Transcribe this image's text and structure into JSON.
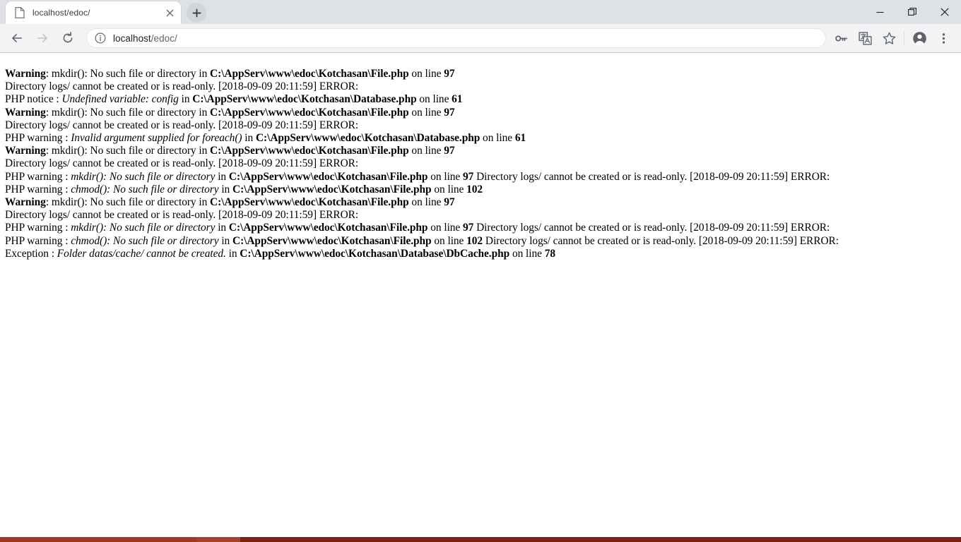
{
  "window": {
    "controls": [
      {
        "name": "minimize",
        "glyph": "minimize-icon"
      },
      {
        "name": "restore",
        "glyph": "restore-icon"
      },
      {
        "name": "close",
        "glyph": "close-icon"
      }
    ]
  },
  "tabstrip": {
    "tabs": [
      {
        "title": "localhost/edoc/",
        "favicon": "page-icon",
        "close_label": "×",
        "active": true
      }
    ],
    "new_tab_label": "+",
    "new_tab_tooltip": "New Tab"
  },
  "toolbar": {
    "back_label": "←",
    "forward_label": "→",
    "reload_label": "⟳",
    "info_icon": "info-circle-icon",
    "url_primary": "localhost",
    "url_secondary": "/edoc/",
    "url_full": "localhost/edoc/",
    "icons": [
      {
        "name": "password-key-icon",
        "label": "⚷"
      },
      {
        "name": "translate-icon",
        "label": "文"
      },
      {
        "name": "bookmark-star-icon",
        "label": "☆"
      },
      {
        "name": "profile-avatar-icon",
        "label": "●"
      },
      {
        "name": "more-menu-icon",
        "label": "⋮"
      }
    ]
  },
  "page": {
    "background_color": "#ffffff",
    "text_color": "#000000",
    "bottom_bar_colors": [
      "#9c3a25",
      "#a8422b",
      "#7b2312"
    ],
    "lines": [
      {
        "id": "line-1",
        "parts": [
          {
            "t": "Warning",
            "s": "b"
          },
          {
            "t": ": mkdir(): No such file or directory in ",
            "s": "n"
          },
          {
            "t": "C:\\AppServ\\www\\edoc\\Kotchasan\\File.php",
            "s": "b"
          },
          {
            "t": " on line ",
            "s": "n"
          },
          {
            "t": "97",
            "s": "b"
          }
        ]
      },
      {
        "id": "line-2",
        "parts": [
          {
            "t": "Directory logs/ cannot be created or is read-only. [2018-09-09 20:11:59] ERROR:",
            "s": "n"
          }
        ]
      },
      {
        "id": "line-3",
        "parts": [
          {
            "t": "PHP notice : ",
            "s": "n"
          },
          {
            "t": "Undefined variable: config",
            "s": "i"
          },
          {
            "t": " in ",
            "s": "n"
          },
          {
            "t": "C:\\AppServ\\www\\edoc\\Kotchasan\\Database.php",
            "s": "b"
          },
          {
            "t": " on line ",
            "s": "n"
          },
          {
            "t": "61",
            "s": "b"
          }
        ]
      },
      {
        "id": "line-4",
        "parts": [
          {
            "t": "Warning",
            "s": "b"
          },
          {
            "t": ": mkdir(): No such file or directory in ",
            "s": "n"
          },
          {
            "t": "C:\\AppServ\\www\\edoc\\Kotchasan\\File.php",
            "s": "b"
          },
          {
            "t": " on line ",
            "s": "n"
          },
          {
            "t": "97",
            "s": "b"
          }
        ]
      },
      {
        "id": "line-5",
        "parts": [
          {
            "t": "Directory logs/ cannot be created or is read-only. [2018-09-09 20:11:59] ERROR:",
            "s": "n"
          }
        ]
      },
      {
        "id": "line-6",
        "parts": [
          {
            "t": "PHP warning : ",
            "s": "n"
          },
          {
            "t": "Invalid argument supplied for foreach()",
            "s": "i"
          },
          {
            "t": " in ",
            "s": "n"
          },
          {
            "t": "C:\\AppServ\\www\\edoc\\Kotchasan\\Database.php",
            "s": "b"
          },
          {
            "t": " on line ",
            "s": "n"
          },
          {
            "t": "61",
            "s": "b"
          }
        ]
      },
      {
        "id": "line-7",
        "parts": [
          {
            "t": "Warning",
            "s": "b"
          },
          {
            "t": ": mkdir(): No such file or directory in ",
            "s": "n"
          },
          {
            "t": "C:\\AppServ\\www\\edoc\\Kotchasan\\File.php",
            "s": "b"
          },
          {
            "t": " on line ",
            "s": "n"
          },
          {
            "t": "97",
            "s": "b"
          }
        ]
      },
      {
        "id": "line-8",
        "parts": [
          {
            "t": "Directory logs/ cannot be created or is read-only. [2018-09-09 20:11:59] ERROR:",
            "s": "n"
          }
        ]
      },
      {
        "id": "line-9",
        "parts": [
          {
            "t": "PHP warning : ",
            "s": "n"
          },
          {
            "t": "mkdir(): No such file or directory",
            "s": "i"
          },
          {
            "t": " in ",
            "s": "n"
          },
          {
            "t": "C:\\AppServ\\www\\edoc\\Kotchasan\\File.php",
            "s": "b"
          },
          {
            "t": " on line ",
            "s": "n"
          },
          {
            "t": "97",
            "s": "b"
          },
          {
            "t": " Directory logs/ cannot be created or is read-only. [2018-09-09 20:11:59] ERROR:",
            "s": "n"
          }
        ]
      },
      {
        "id": "line-10",
        "parts": [
          {
            "t": "PHP warning : ",
            "s": "n"
          },
          {
            "t": "chmod(): No such file or directory",
            "s": "i"
          },
          {
            "t": " in ",
            "s": "n"
          },
          {
            "t": "C:\\AppServ\\www\\edoc\\Kotchasan\\File.php",
            "s": "b"
          },
          {
            "t": " on line ",
            "s": "n"
          },
          {
            "t": "102",
            "s": "b"
          }
        ]
      },
      {
        "id": "line-11",
        "parts": [
          {
            "t": "Warning",
            "s": "b"
          },
          {
            "t": ": mkdir(): No such file or directory in ",
            "s": "n"
          },
          {
            "t": "C:\\AppServ\\www\\edoc\\Kotchasan\\File.php",
            "s": "b"
          },
          {
            "t": " on line ",
            "s": "n"
          },
          {
            "t": "97",
            "s": "b"
          }
        ]
      },
      {
        "id": "line-12",
        "parts": [
          {
            "t": "Directory logs/ cannot be created or is read-only. [2018-09-09 20:11:59] ERROR:",
            "s": "n"
          }
        ]
      },
      {
        "id": "line-13",
        "parts": [
          {
            "t": "PHP warning : ",
            "s": "n"
          },
          {
            "t": "mkdir(): No such file or directory",
            "s": "i"
          },
          {
            "t": " in ",
            "s": "n"
          },
          {
            "t": "C:\\AppServ\\www\\edoc\\Kotchasan\\File.php",
            "s": "b"
          },
          {
            "t": " on line ",
            "s": "n"
          },
          {
            "t": "97",
            "s": "b"
          },
          {
            "t": " Directory logs/ cannot be created or is read-only. [2018-09-09 20:11:59] ERROR:",
            "s": "n"
          }
        ]
      },
      {
        "id": "line-14",
        "parts": [
          {
            "t": "PHP warning : ",
            "s": "n"
          },
          {
            "t": "chmod(): No such file or directory",
            "s": "i"
          },
          {
            "t": " in ",
            "s": "n"
          },
          {
            "t": "C:\\AppServ\\www\\edoc\\Kotchasan\\File.php",
            "s": "b"
          },
          {
            "t": " on line ",
            "s": "n"
          },
          {
            "t": "102",
            "s": "b"
          },
          {
            "t": " Directory logs/ cannot be created or is read-only. [2018-09-09 20:11:59] ERROR:",
            "s": "n"
          }
        ]
      },
      {
        "id": "line-15",
        "parts": [
          {
            "t": "Exception : ",
            "s": "n"
          },
          {
            "t": "Folder datas/cache/ cannot be created.",
            "s": "i"
          },
          {
            "t": " in ",
            "s": "n"
          },
          {
            "t": "C:\\AppServ\\www\\edoc\\Kotchasan\\Database\\DbCache.php",
            "s": "b"
          },
          {
            "t": " on line ",
            "s": "n"
          },
          {
            "t": "78",
            "s": "b"
          }
        ]
      }
    ]
  }
}
